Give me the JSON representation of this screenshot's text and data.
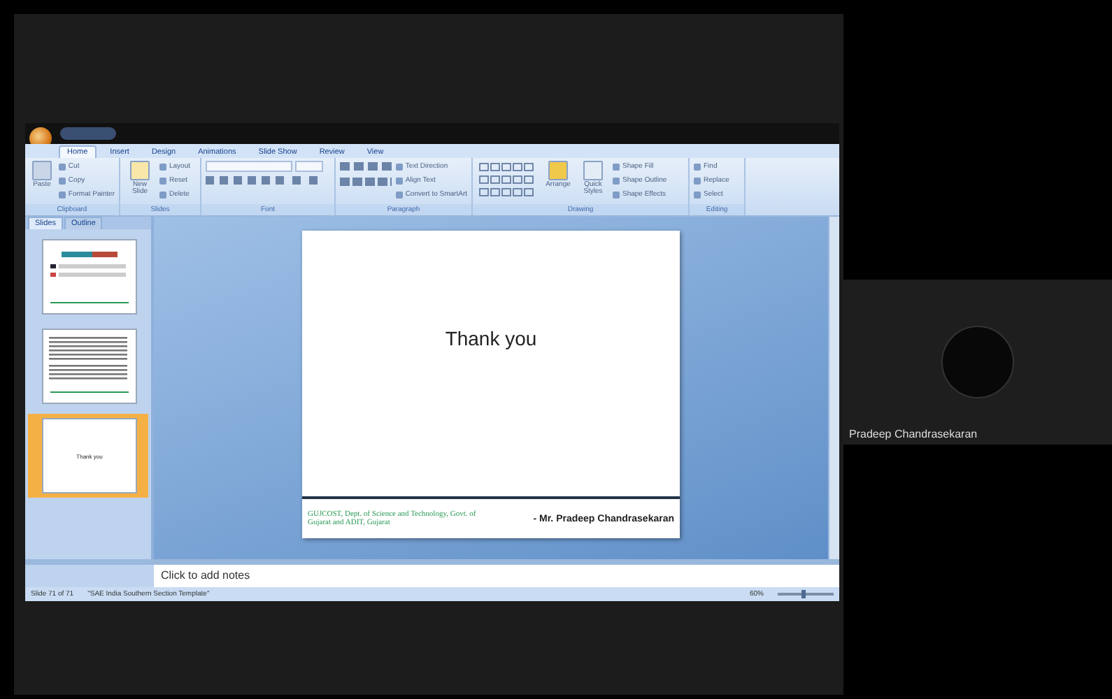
{
  "ribbon_tabs": [
    {
      "label": "Home",
      "selected": true
    },
    {
      "label": "Insert",
      "selected": false
    },
    {
      "label": "Design",
      "selected": false
    },
    {
      "label": "Animations",
      "selected": false
    },
    {
      "label": "Slide Show",
      "selected": false
    },
    {
      "label": "Review",
      "selected": false
    },
    {
      "label": "View",
      "selected": false
    }
  ],
  "ribbon_groups": [
    {
      "label": "Clipboard",
      "kind": "clipboard",
      "big": "Paste",
      "items": [
        "Cut",
        "Copy",
        "Format Painter"
      ]
    },
    {
      "label": "Slides",
      "kind": "slides",
      "big": "New Slide",
      "items": [
        "Layout",
        "Reset",
        "Delete"
      ]
    },
    {
      "label": "Font",
      "kind": "font"
    },
    {
      "label": "Paragraph",
      "kind": "paragraph",
      "items": [
        "Text Direction",
        "Align Text",
        "Convert to SmartArt"
      ]
    },
    {
      "label": "Drawing",
      "kind": "drawing",
      "big": "Arrange",
      "big2": "Quick Styles",
      "items": [
        "Shape Fill",
        "Shape Outline",
        "Shape Effects"
      ]
    },
    {
      "label": "Editing",
      "kind": "editing",
      "items": [
        "Find",
        "Replace",
        "Select"
      ]
    }
  ],
  "panel_tabs": [
    {
      "label": "Slides",
      "selected": true
    },
    {
      "label": "Outline",
      "selected": false
    }
  ],
  "thumbnails": [
    {
      "kind": "chart",
      "selected": false
    },
    {
      "kind": "text",
      "selected": false
    },
    {
      "kind": "title",
      "selected": true,
      "text": "Thank you"
    }
  ],
  "slide": {
    "title": "Thank you",
    "footer_left": "GUJCOST, Dept. of Science and Technology, Govt. of Gujarat and ADIT, Gujarat",
    "footer_right": "- Mr. Pradeep Chandrasekaran"
  },
  "notes": {
    "placeholder": "Click to add notes"
  },
  "status_bar": {
    "slide": "Slide 71 of 71",
    "theme": "\"SAE India Southern Section Template\"",
    "zoom": "60%",
    "zoom_slider": {
      "level": 0.45
    }
  },
  "participant": {
    "name": "Pradeep Chandrasekaran"
  }
}
